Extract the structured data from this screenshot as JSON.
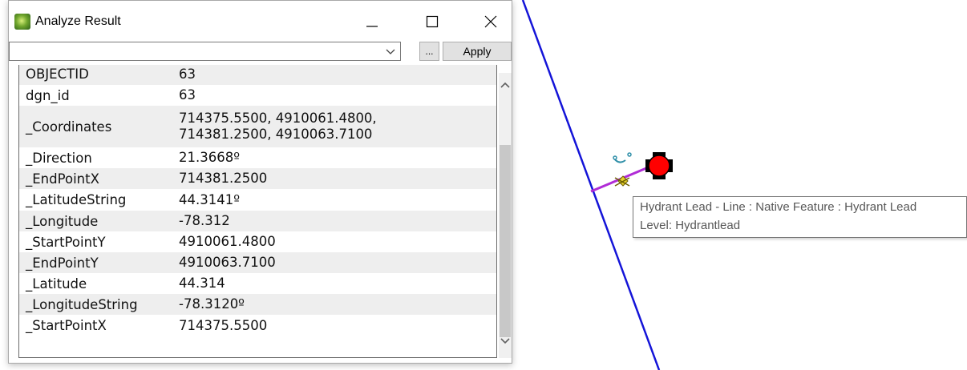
{
  "window": {
    "title": "Analyze Result",
    "icon": "app-globe-icon"
  },
  "toolbar": {
    "select_value": "",
    "ellipsis_label": "...",
    "apply_label": "Apply"
  },
  "properties": [
    {
      "name": "OBJECTID",
      "value": "63"
    },
    {
      "name": "dgn_id",
      "value": "63"
    },
    {
      "name": "_Coordinates",
      "value": "714375.5500, 4910061.4800,\n714381.2500, 4910063.7100"
    },
    {
      "name": "_Direction",
      "value": "21.3668º"
    },
    {
      "name": "_EndPointX",
      "value": "714381.2500"
    },
    {
      "name": "_LatitudeString",
      "value": "44.3141º"
    },
    {
      "name": "_Longitude",
      "value": "-78.312"
    },
    {
      "name": "_StartPointY",
      "value": "4910061.4800"
    },
    {
      "name": "_EndPointY",
      "value": "4910063.7100"
    },
    {
      "name": "_Latitude",
      "value": "44.314"
    },
    {
      "name": "_LongitudeString",
      "value": "-78.3120º"
    },
    {
      "name": "_StartPointX",
      "value": "714375.5500"
    }
  ],
  "tooltip": {
    "line1": "Hydrant Lead - Line : Native Feature : Hydrant Lead",
    "line2": "Level: Hydrantlead"
  },
  "colors": {
    "main_line": "#1414d8",
    "hydrant_lead": "#b02bd6",
    "hydrant": "#ff0000",
    "snap_marker": "#e6d12b"
  }
}
